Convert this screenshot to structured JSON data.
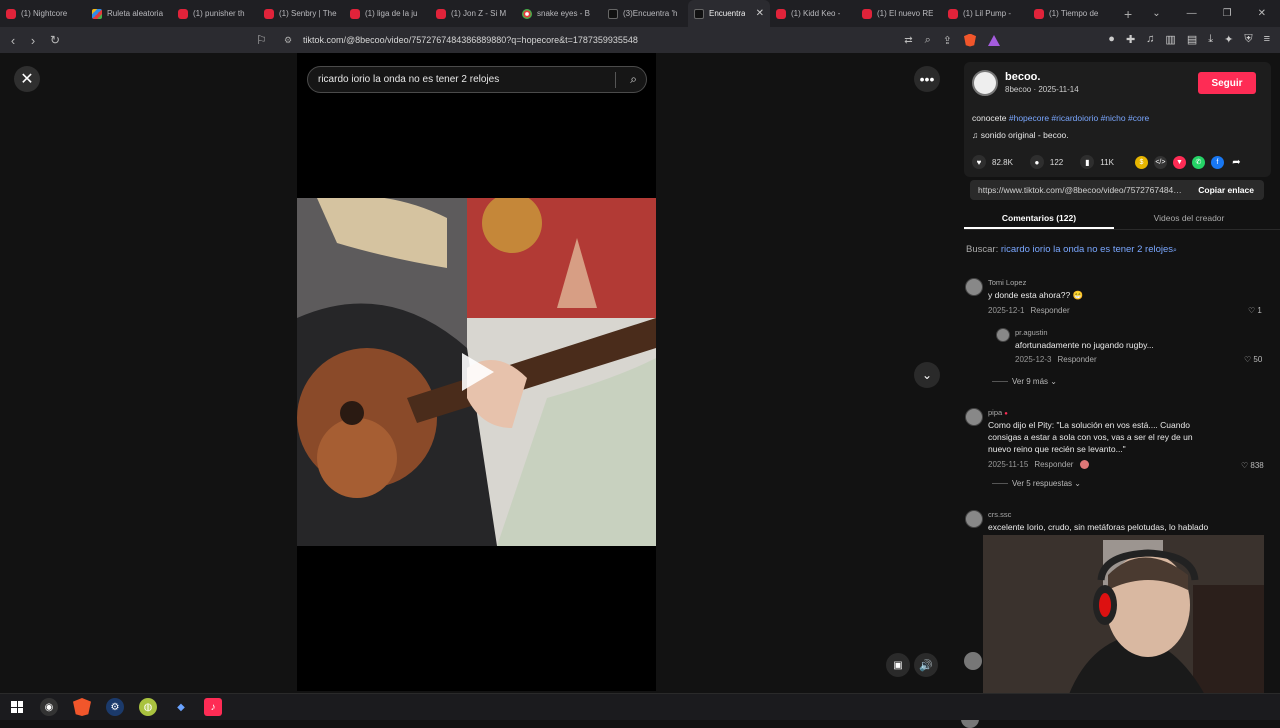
{
  "browser": {
    "tabs": [
      {
        "title": "(1) Nightcore",
        "icon": "youtube-icon"
      },
      {
        "title": "Ruleta aleatoria",
        "icon": "wheel-icon"
      },
      {
        "title": "(1) punisher th",
        "icon": "youtube-icon"
      },
      {
        "title": "(1) Senbry | The",
        "icon": "youtube-icon"
      },
      {
        "title": "(1) liga de la ju",
        "icon": "youtube-icon"
      },
      {
        "title": "(1) Jon Z - Si M",
        "icon": "youtube-icon"
      },
      {
        "title": "snake eyes - B",
        "icon": "chrome-icon"
      },
      {
        "title": "(3)Encuentra 'h",
        "icon": "tiktok-icon"
      },
      {
        "title": "Encuentra",
        "icon": "tiktok-icon",
        "active": true
      },
      {
        "title": "(1) Kidd Keo -",
        "icon": "youtube-icon"
      },
      {
        "title": "(1) El nuevo RE",
        "icon": "youtube-icon"
      },
      {
        "title": "(1) Lil Pump -",
        "icon": "youtube-icon"
      },
      {
        "title": "(1) Tiempo de",
        "icon": "youtube-icon"
      }
    ],
    "url": "tiktok.com/@8becoo/video/7572767484386889880?q=hopecore&t=1787359935548"
  },
  "search": {
    "value": "ricardo iorio la onda no es tener 2 relojes"
  },
  "author": {
    "name": "becoo.",
    "handle": "8becoo",
    "date": "2025-11-14",
    "follow_label": "Seguir"
  },
  "caption": {
    "text": "conocete ",
    "tags": [
      "#hopecore",
      "#ricardoiorio",
      "#nicho",
      "#core"
    ]
  },
  "music": "sonido original - becoo.",
  "stats": {
    "likes": "82.8K",
    "comments": "122",
    "saves": "11K"
  },
  "link": {
    "url": "https://www.tiktok.com/@8becoo/video/7572767484386889880",
    "copy_label": "Copiar enlace"
  },
  "tabs": {
    "comments": "Comentarios (122)",
    "creator_videos": "Videos del creador"
  },
  "related": {
    "prefix": "Buscar: ",
    "query": "ricardo iorio la onda no es tener 2 relojes"
  },
  "comments": [
    {
      "user": "Tomi Lopez",
      "text": "y donde esta ahora?? 😁",
      "date": "2025-12-1",
      "reply": "Responder",
      "likes": "1"
    },
    {
      "user": "pr.agustin",
      "text": "afortunadamente no jugando rugby...",
      "date": "2025-12-3",
      "reply": "Responder",
      "likes": "50"
    },
    {
      "user": "pipa",
      "text": "Como dijo el Pity: \"La solución en vos está.... Cuando consigas a estar a sola con vos, vas a ser el rey de un nuevo reino que recién se levanto...\"",
      "date": "2025-11-15",
      "reply": "Responder",
      "likes": "838"
    },
    {
      "user": "crs.ssc",
      "text": "excelente Iorio, crudo, sin metáforas pelotudas, lo hablado"
    }
  ],
  "more_replies_1": "Ver 9 más",
  "more_replies_2": "Ver 5 respuestas",
  "colors": {
    "accent": "#fe2c55",
    "link": "#7aa7ff"
  }
}
